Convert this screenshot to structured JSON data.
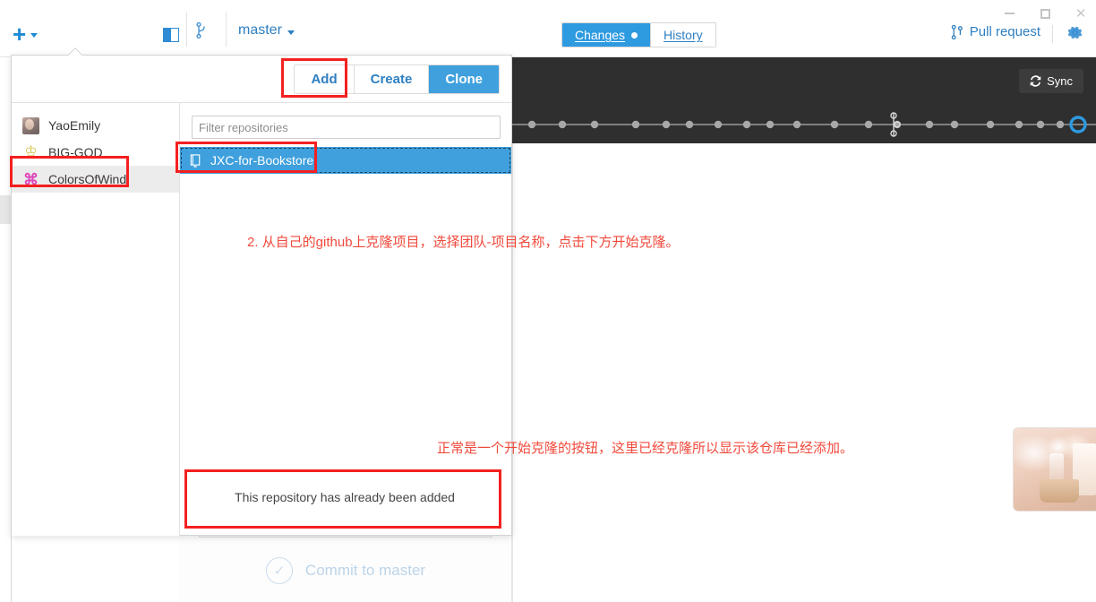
{
  "window": {
    "minimize_label": "—",
    "maximize_label": "□",
    "close_label": "✕"
  },
  "toolbar": {
    "add_menu_icon": "plus-icon",
    "panel_toggle_icon": "sidebar-toggle-icon",
    "branch_icon": "branch-icon",
    "branch_name": "master",
    "tabs": [
      {
        "label": "Changes",
        "active": true,
        "has_dot": true
      },
      {
        "label": "History",
        "active": false,
        "has_dot": false
      }
    ],
    "pull_request_label": "Pull request",
    "pull_request_icon": "pull-request-icon",
    "settings_icon": "gear-icon"
  },
  "history_strip": {
    "sync_label": "Sync",
    "sync_icon": "sync-icon",
    "commit_count": 22,
    "head_marker": true,
    "background_color": "#2f2f2f"
  },
  "popup": {
    "tabs": [
      {
        "label": "Add",
        "active": false
      },
      {
        "label": "Create",
        "active": false
      },
      {
        "label": "Clone",
        "active": true
      }
    ],
    "accounts": [
      {
        "label": "YaoEmily",
        "avatar": "photo",
        "selected": false
      },
      {
        "label": "BIG-GOD",
        "avatar": "crown",
        "selected": false
      },
      {
        "label": "ColorsOfWind",
        "avatar": "pink-logo",
        "selected": true
      }
    ],
    "filter": {
      "placeholder": "Filter repositories",
      "value": ""
    },
    "repositories": [
      {
        "label": "JXC-for-Bookstore",
        "icon": "repository-icon",
        "selected": true
      }
    ],
    "footer_message": "This repository has already been added"
  },
  "background": {
    "commit_message_placeholder": "",
    "commit_button_label": "Commit to master",
    "commit_check_icon": "check-icon"
  },
  "annotations": [
    {
      "id": "annotation-clone-step",
      "text": "2. 从自己的github上克隆项目，选择团队-项目名称，点击下方开始克隆。",
      "color": "#f04a3c"
    },
    {
      "id": "annotation-already-added",
      "text": "正常是一个开始克隆的按钮，这里已经克隆所以显示该仓库已经添加。",
      "color": "#f04a3c"
    }
  ],
  "highlight_color": "#f42020",
  "accent_color": "#3fa0dd"
}
